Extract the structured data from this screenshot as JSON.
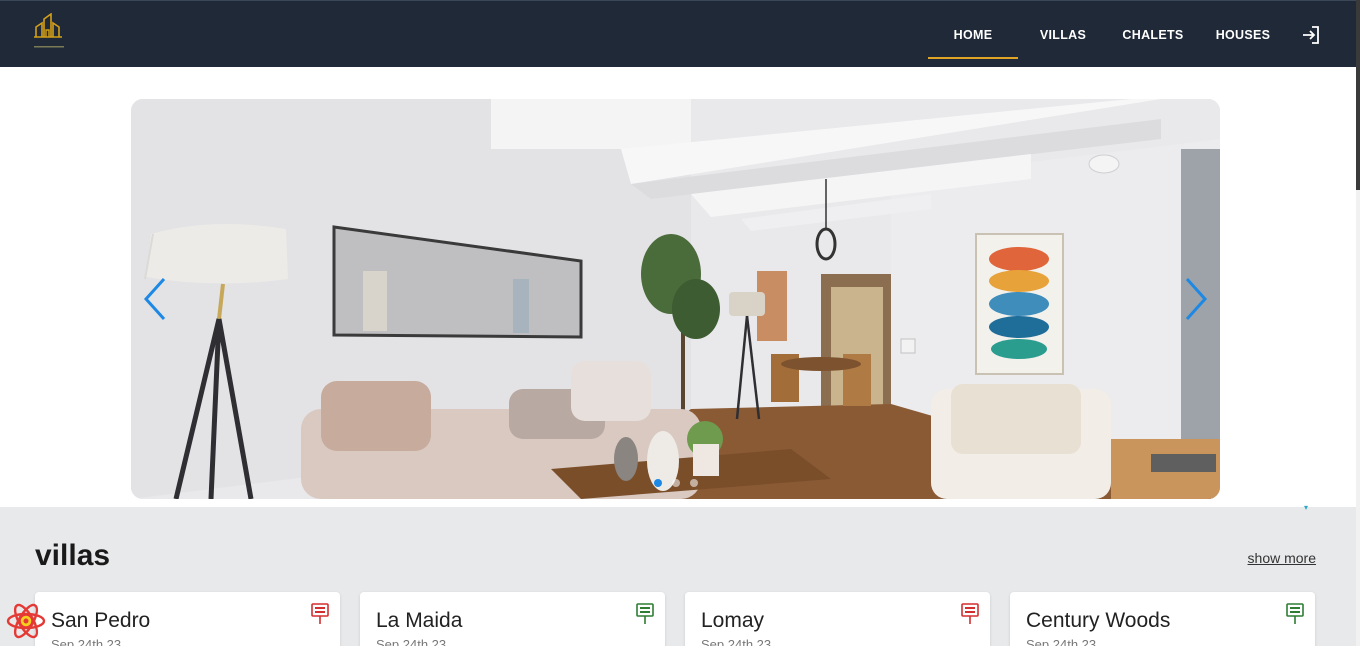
{
  "nav": {
    "logo_icon": "building-logo-icon",
    "links": [
      {
        "label": "HOME"
      },
      {
        "label": "VILLAS"
      },
      {
        "label": "CHALETS"
      },
      {
        "label": "HOUSES"
      }
    ],
    "login_icon": "sign-in-icon",
    "active_index": 0
  },
  "hero": {
    "image": "living-room-interior",
    "prev_icon": "chevron-left-icon",
    "next_icon": "chevron-right-icon",
    "slides": 3,
    "active_slide": 0
  },
  "section": {
    "title": "villas",
    "show_more": "show more"
  },
  "cards": [
    {
      "title": "San Pedro",
      "date": "Sep 24th 23",
      "tag": "for-sale-sign-icon",
      "tag_color": "#d32f2f"
    },
    {
      "title": "La Maida",
      "date": "Sep 24th 23",
      "tag": "for-rent-sign-icon",
      "tag_color": "#2e7d32"
    },
    {
      "title": "Lomay",
      "date": "Sep 24th 23",
      "tag": "for-sale-sign-icon",
      "tag_color": "#d32f2f"
    },
    {
      "title": "Century Woods",
      "date": "Sep 24th 23",
      "tag": "for-rent-sign-icon",
      "tag_color": "#2e7d32"
    }
  ],
  "colors": {
    "navbar": "#1f2937",
    "accent": "#e0a526",
    "carousel_arrow": "#1e88e5",
    "section_bg": "#e8e9eb"
  }
}
